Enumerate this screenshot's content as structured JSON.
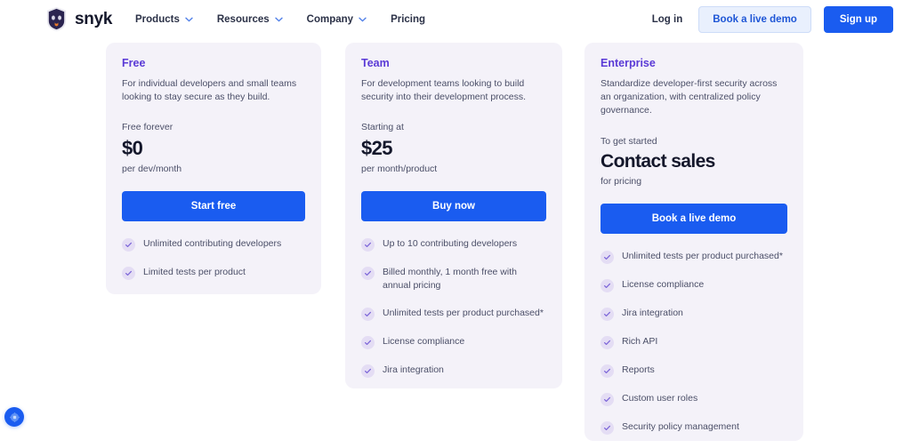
{
  "header": {
    "logo": {
      "text": "snyk",
      "icon": "snyk-dog-logo-icon"
    },
    "nav": [
      {
        "label": "Products",
        "has_chevron": true
      },
      {
        "label": "Resources",
        "has_chevron": true
      },
      {
        "label": "Company",
        "has_chevron": true
      },
      {
        "label": "Pricing",
        "has_chevron": false
      }
    ],
    "login_label": "Log in",
    "demo_label": "Book a live demo",
    "signup_label": "Sign up"
  },
  "plans": [
    {
      "name": "Free",
      "description": "For individual developers and small teams looking to stay secure as they build.",
      "price_label": "Free forever",
      "price_value": "$0",
      "price_unit": "per dev/month",
      "cta_label": "Start free",
      "features": [
        "Unlimited contributing developers",
        "Limited tests per product"
      ]
    },
    {
      "name": "Team",
      "description": "For development teams looking to build security into their development process.",
      "price_label": "Starting at",
      "price_value": "$25",
      "price_unit": "per month/product",
      "cta_label": "Buy now",
      "features": [
        "Up to 10 contributing developers",
        "Billed monthly, 1 month free with annual pricing",
        "Unlimited tests per product purchased*",
        "License compliance",
        "Jira integration"
      ]
    },
    {
      "name": "Enterprise",
      "description": "Standardize developer-first security across an organization, with centralized policy governance.",
      "price_label": "To get started",
      "price_value": "Contact sales",
      "price_unit": "for pricing",
      "cta_label": "Book a live demo",
      "features": [
        "Unlimited tests per product purchased*",
        "License compliance",
        "Jira integration",
        "Rich API",
        "Reports",
        "Custom user roles",
        "Security policy management"
      ]
    }
  ],
  "floating_widget": {
    "icon": "cookie-settings-icon"
  },
  "colors": {
    "accent_blue": "#1a5cf0",
    "plan_purple": "#5a3ad6",
    "card_bg": "#f4f2f9",
    "text_dark": "#14172b",
    "text_muted": "#4b4f68"
  }
}
